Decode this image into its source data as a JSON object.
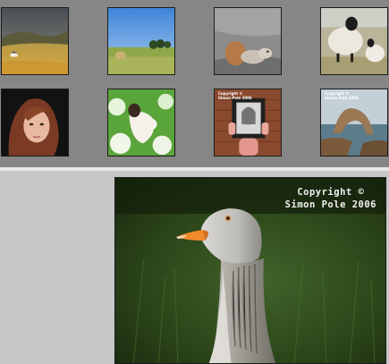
{
  "filmstrip": {
    "thumbnails": [
      {
        "subject": "highland-landscape"
      },
      {
        "subject": "hay-bale-field"
      },
      {
        "subject": "squirrel"
      },
      {
        "subject": "sheep"
      },
      {
        "subject": "woman-portrait"
      },
      {
        "subject": "woman-in-flowers"
      },
      {
        "subject": "frame-portrait",
        "watermark_line1": "Copyright ©",
        "watermark_line2": "Simon Pole 2006"
      },
      {
        "subject": "coastal-rock-arch",
        "watermark_line1": "Copyright ©",
        "watermark_line2": "Simon Pole 2006"
      }
    ]
  },
  "preview": {
    "subject": "goose",
    "watermark_line1": "Copyright ©",
    "watermark_line2": "Simon Pole 2006"
  },
  "colors": {
    "filmstrip_bg": "#868686",
    "panel_bg": "#c6c6c6",
    "watermark": "#f2f2f2"
  }
}
